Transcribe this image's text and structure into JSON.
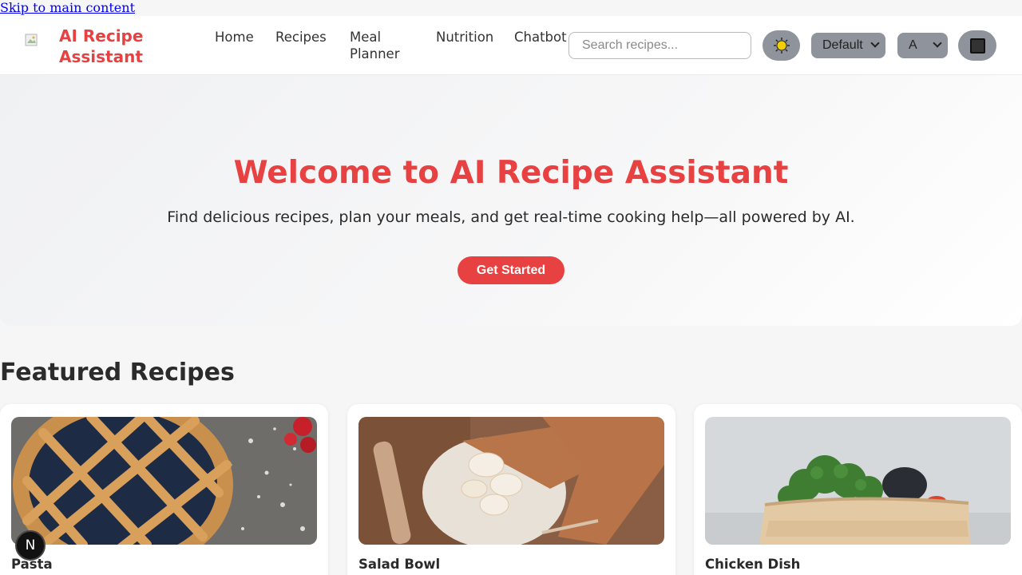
{
  "skip_link": "Skip to main content",
  "brand": {
    "name": "AI Recipe Assistant",
    "logo_icon": "broken-image-icon",
    "color": "#e84142"
  },
  "nav": {
    "links": [
      "Home",
      "Recipes",
      "Meal Planner",
      "Nutrition",
      "Chatbot"
    ],
    "search_placeholder": "Search recipes...",
    "theme_icon": "sun-icon",
    "style_select": "Default",
    "font_select": "A",
    "contrast_icon": "contrast-square-icon"
  },
  "hero": {
    "title": "Welcome to AI Recipe Assistant",
    "subtitle": "Find delicious recipes, plan your meals, and get real-time cooking help—all powered by AI.",
    "cta": "Get Started"
  },
  "featured": {
    "title": "Featured Recipes",
    "cards": [
      {
        "title": "Pasta",
        "image": "pie-photo"
      },
      {
        "title": "Salad Bowl",
        "image": "pancakes-photo"
      },
      {
        "title": "Chicken Dish",
        "image": "broccoli-basket-photo"
      }
    ]
  },
  "badge": "N",
  "colors": {
    "accent": "#e84142",
    "pill": "#8e939c",
    "background": "#f6f6f7"
  }
}
